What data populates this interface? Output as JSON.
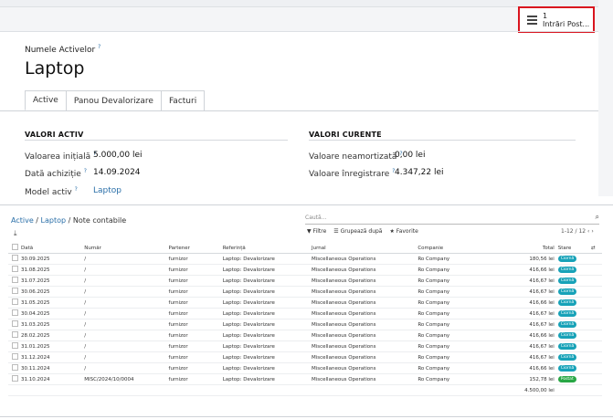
{
  "smart_button": {
    "count": "1",
    "label": "Intrări Post..."
  },
  "form": {
    "name_label": "Numele Activelor",
    "help_mark": "?",
    "name": "Laptop",
    "tabs": [
      "Active",
      "Panou Devalorizare",
      "Facturi"
    ],
    "values_asset_title": "VALORI ACTIV",
    "values_current_title": "VALORI CURENTE",
    "fields_left": [
      {
        "label": "Valoarea inițială",
        "value": "5.000,00 lei"
      },
      {
        "label": "Dată achiziție",
        "value": "14.09.2024"
      },
      {
        "label": "Model activ",
        "value": "Laptop"
      }
    ],
    "fields_right": [
      {
        "label": "Valoare neamortizată",
        "value": "0,00 lei"
      },
      {
        "label": "Valoare înregistrare",
        "value": "4.347,22 lei"
      }
    ]
  },
  "list": {
    "breadcrumb": {
      "root": "Active",
      "sep1": " / ",
      "mid": "Laptop",
      "sep2": " / ",
      "current": "Note contabile"
    },
    "search_placeholder": "Caută...",
    "filter_label": "Filtre",
    "group_label": "Grupează după",
    "fav_label": "Favorite",
    "pager": "1-12 / 12",
    "columns": [
      "Dată",
      "Număr",
      "Partener",
      "Referință",
      "Jurnal",
      "Companie",
      "Total",
      "Stare"
    ],
    "rows": [
      {
        "date": "30.09.2025",
        "number": "/",
        "partner": "furnizor",
        "ref": "Laptop: Devalorizare",
        "journal": "Miscellaneous Operations",
        "company": "Ro Company",
        "total": "180,56 lei",
        "state": "Ciornă",
        "state_kind": "draft"
      },
      {
        "date": "31.08.2025",
        "number": "/",
        "partner": "furnizor",
        "ref": "Laptop: Devalorizare",
        "journal": "Miscellaneous Operations",
        "company": "Ro Company",
        "total": "416,66 lei",
        "state": "Ciornă",
        "state_kind": "draft"
      },
      {
        "date": "31.07.2025",
        "number": "/",
        "partner": "furnizor",
        "ref": "Laptop: Devalorizare",
        "journal": "Miscellaneous Operations",
        "company": "Ro Company",
        "total": "416,67 lei",
        "state": "Ciornă",
        "state_kind": "draft"
      },
      {
        "date": "30.06.2025",
        "number": "/",
        "partner": "furnizor",
        "ref": "Laptop: Devalorizare",
        "journal": "Miscellaneous Operations",
        "company": "Ro Company",
        "total": "416,67 lei",
        "state": "Ciornă",
        "state_kind": "draft"
      },
      {
        "date": "31.05.2025",
        "number": "/",
        "partner": "furnizor",
        "ref": "Laptop: Devalorizare",
        "journal": "Miscellaneous Operations",
        "company": "Ro Company",
        "total": "416,66 lei",
        "state": "Ciornă",
        "state_kind": "draft"
      },
      {
        "date": "30.04.2025",
        "number": "/",
        "partner": "furnizor",
        "ref": "Laptop: Devalorizare",
        "journal": "Miscellaneous Operations",
        "company": "Ro Company",
        "total": "416,67 lei",
        "state": "Ciornă",
        "state_kind": "draft"
      },
      {
        "date": "31.03.2025",
        "number": "/",
        "partner": "furnizor",
        "ref": "Laptop: Devalorizare",
        "journal": "Miscellaneous Operations",
        "company": "Ro Company",
        "total": "416,67 lei",
        "state": "Ciornă",
        "state_kind": "draft"
      },
      {
        "date": "28.02.2025",
        "number": "/",
        "partner": "furnizor",
        "ref": "Laptop: Devalorizare",
        "journal": "Miscellaneous Operations",
        "company": "Ro Company",
        "total": "416,66 lei",
        "state": "Ciornă",
        "state_kind": "draft"
      },
      {
        "date": "31.01.2025",
        "number": "/",
        "partner": "furnizor",
        "ref": "Laptop: Devalorizare",
        "journal": "Miscellaneous Operations",
        "company": "Ro Company",
        "total": "416,67 lei",
        "state": "Ciornă",
        "state_kind": "draft"
      },
      {
        "date": "31.12.2024",
        "number": "/",
        "partner": "furnizor",
        "ref": "Laptop: Devalorizare",
        "journal": "Miscellaneous Operations",
        "company": "Ro Company",
        "total": "416,67 lei",
        "state": "Ciornă",
        "state_kind": "draft"
      },
      {
        "date": "30.11.2024",
        "number": "/",
        "partner": "furnizor",
        "ref": "Laptop: Devalorizare",
        "journal": "Miscellaneous Operations",
        "company": "Ro Company",
        "total": "416,66 lei",
        "state": "Ciornă",
        "state_kind": "draft"
      },
      {
        "date": "31.10.2024",
        "number": "MISC/2024/10/0004",
        "partner": "furnizor",
        "ref": "Laptop: Devalorizare",
        "journal": "Miscellaneous Operations",
        "company": "Ro Company",
        "total": "152,78 lei",
        "state": "Postat",
        "state_kind": "posted"
      }
    ],
    "grand_total": "4.500,00 lei"
  },
  "colors": {
    "accent": "#2a6fa8",
    "highlight_box": "#d9141e",
    "draft_badge": "#17a2b8",
    "posted_badge": "#28a745"
  }
}
